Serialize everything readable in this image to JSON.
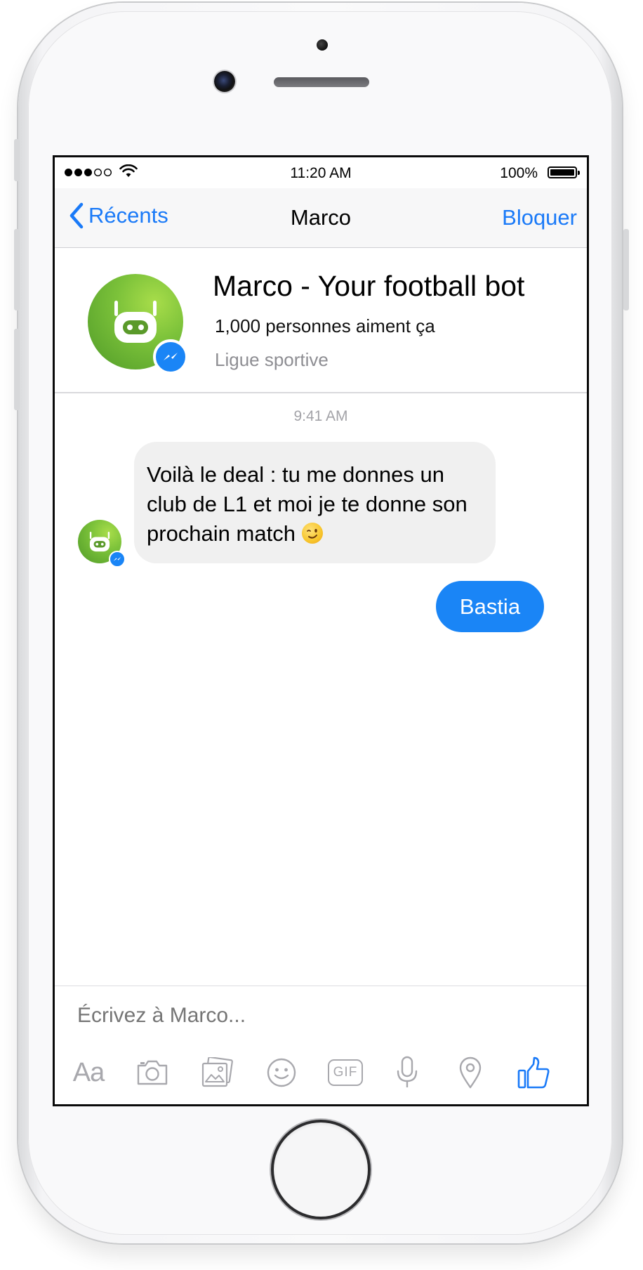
{
  "status_bar": {
    "time": "11:20 AM",
    "battery": "100%",
    "signal_bars_filled": 3,
    "signal_bars_total": 5
  },
  "nav": {
    "back_label": "Récents",
    "title": "Marco",
    "block_label": "Bloquer"
  },
  "profile": {
    "name": "Marco - Your football bot",
    "likes": "1,000 personnes aiment ça",
    "category": "Ligue sportive"
  },
  "conversation": {
    "timestamp": "9:41 AM",
    "bot_message": "Voilà le deal : tu me donnes un club de L1 et moi je te donne son prochain match",
    "bot_emoji": "winking-face",
    "user_message": "Bastia"
  },
  "composer": {
    "placeholder": "Écrivez à Marco...",
    "text_tool_label": "Aa",
    "gif_label": "GIF",
    "tools": [
      "text-icon",
      "camera-icon",
      "photo-icon",
      "emoji-icon",
      "gif-icon",
      "microphone-icon",
      "location-icon",
      "like-icon"
    ]
  },
  "colors": {
    "accent": "#1a7af8",
    "bubble_out": "#1a85f6",
    "bubble_in": "#f0f0f0",
    "bot_green": "#7cc23a",
    "placeholder": "#c4c4c8",
    "tool_icon": "#a8a8ad"
  }
}
